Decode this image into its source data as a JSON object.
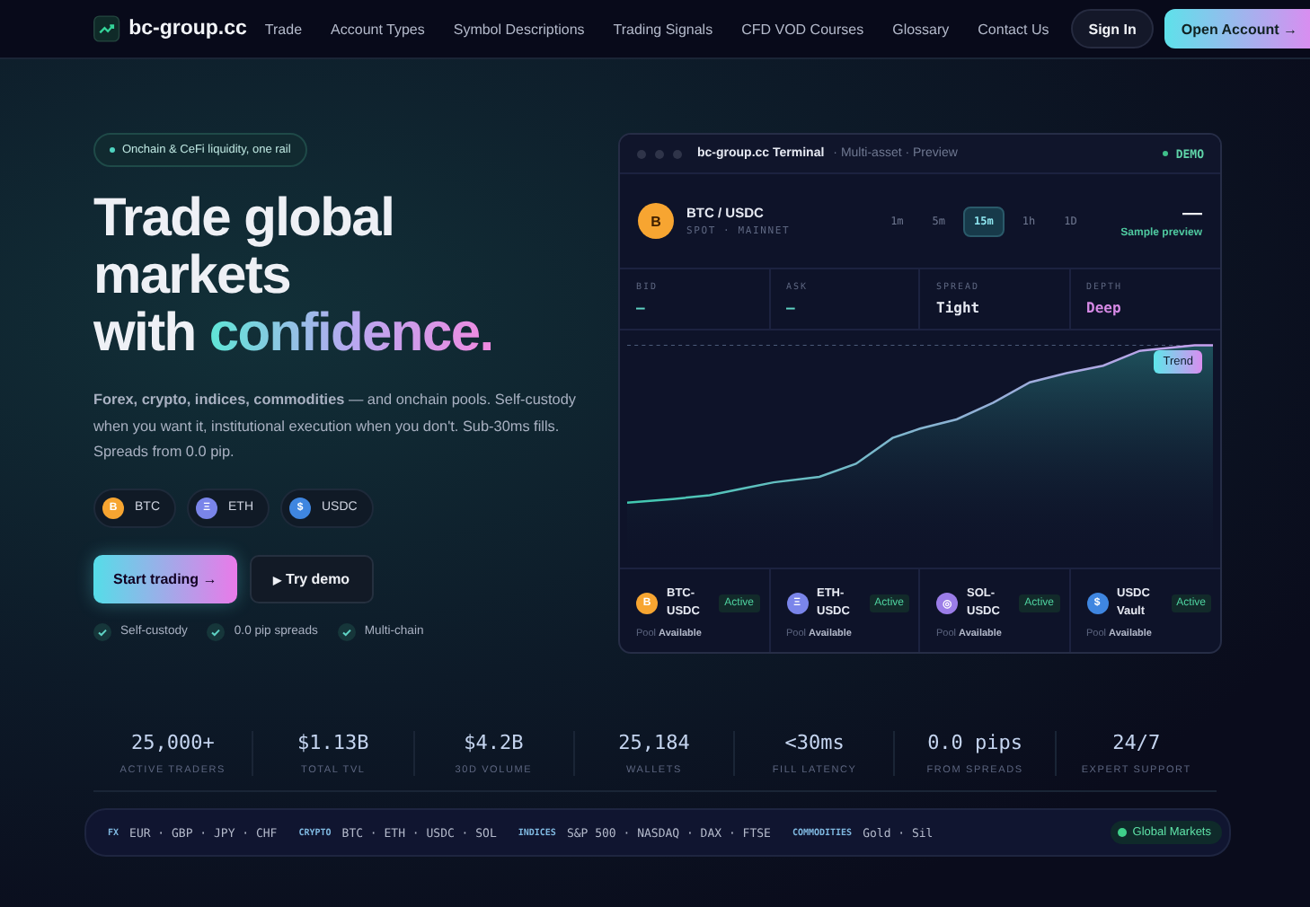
{
  "nav": {
    "brand": "bc-group.cc",
    "links": [
      "Trade",
      "Account Types",
      "Symbol Descriptions",
      "Trading Signals",
      "CFD VOD Courses",
      "Glossary",
      "Contact Us"
    ],
    "sign_in": "Sign In",
    "open_account": "Open Account",
    "open_account_arrow": "→"
  },
  "hero": {
    "badge": "Onchain & CeFi liquidity, one rail",
    "title_lines": [
      "Trade global",
      "markets",
      "with"
    ],
    "title_accent": "confidence.",
    "lead": "**Forex, crypto, indices, commodities** — and onchain pools. Self-custody when you want it, institutional execution when you don't. Sub-30ms fills. Spreads from 0.0 pip.",
    "coins": [
      {
        "glyph": "B",
        "label": "BTC",
        "color": "#f7a531"
      },
      {
        "glyph": "Ξ",
        "label": "ETH",
        "color": "#7a85ea"
      },
      {
        "glyph": "$",
        "label": "USDC",
        "color": "#3f86e0"
      }
    ],
    "primary_button": "Start trading",
    "primary_arrow": "→",
    "secondary_icon": "▶",
    "secondary_button": "Try demo",
    "checks": [
      "Self-custody",
      "0.0 pip spreads",
      "Multi-chain"
    ]
  },
  "terminal": {
    "title": "bc-group.cc Terminal",
    "subtitle": "· Multi-asset · Preview",
    "mode": "DEMO",
    "pair_glyph": "B",
    "pair": "BTC / USDC",
    "pair_sub": "SPOT · MAINNET",
    "timeframes": [
      {
        "label": "1m",
        "selected": false
      },
      {
        "label": "5m",
        "selected": false
      },
      {
        "label": "15m",
        "selected": true
      },
      {
        "label": "1h",
        "selected": false
      },
      {
        "label": "1D",
        "selected": false
      }
    ],
    "price": "—",
    "sample": "Sample preview",
    "quotes": [
      {
        "label": "BID",
        "value": "—",
        "kind": "dash"
      },
      {
        "label": "ASK",
        "value": "—",
        "kind": "dash"
      },
      {
        "label": "SPREAD",
        "value": "Tight",
        "kind": "plain"
      },
      {
        "label": "DEPTH",
        "value": "Deep",
        "kind": "accent"
      }
    ],
    "chart_tag": "Trend",
    "pools": [
      {
        "glyph": "B",
        "name": "BTC-USDC",
        "status": "Active",
        "pool": "Pool",
        "avail": "Available",
        "color": "#f7a531"
      },
      {
        "glyph": "Ξ",
        "name": "ETH-USDC",
        "status": "Active",
        "pool": "Pool",
        "avail": "Available",
        "color": "#7a85ea"
      },
      {
        "glyph": "◎",
        "name": "SOL-USDC",
        "status": "Active",
        "pool": "Pool",
        "avail": "Available",
        "color": "#9b7de8"
      },
      {
        "glyph": "$",
        "name": "USDC Vault",
        "status": "Active",
        "pool": "Pool",
        "avail": "Available",
        "color": "#3f86e0"
      }
    ]
  },
  "stats": [
    {
      "value": "25,000+",
      "label": "ACTIVE TRADERS"
    },
    {
      "value": "$1.13B",
      "label": "TOTAL TVL"
    },
    {
      "value": "$4.2B",
      "label": "30D VOLUME"
    },
    {
      "value": "25,184",
      "label": "WALLETS"
    },
    {
      "value": "<30ms",
      "label": "FILL LATENCY"
    },
    {
      "value": "0.0 pips",
      "label": "FROM SPREADS"
    },
    {
      "value": "24/7",
      "label": "EXPERT SUPPORT"
    }
  ],
  "ticker": {
    "groups": [
      {
        "label": "FX",
        "items": "EUR · GBP · JPY · CHF"
      },
      {
        "label": "CRYPTO",
        "items": "BTC · ETH · USDC · SOL"
      },
      {
        "label": "INDICES",
        "items": "S&P 500 · NASDAQ · DAX · FTSE"
      },
      {
        "label": "COMMODITIES",
        "items": "Gold · Sil"
      }
    ],
    "badge": "Global Markets"
  }
}
